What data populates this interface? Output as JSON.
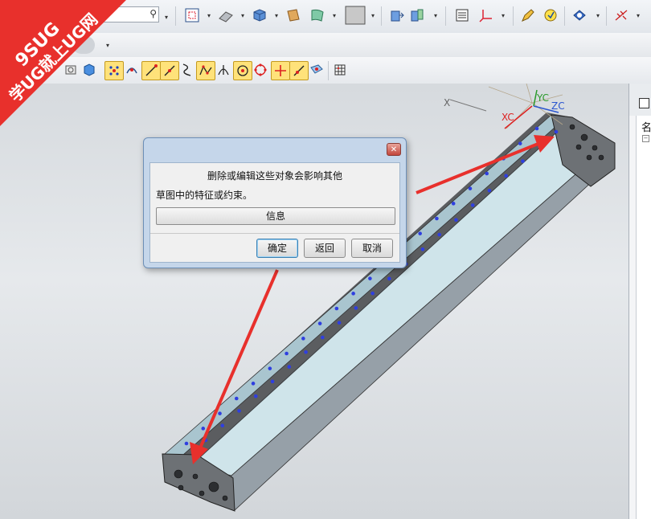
{
  "watermark": {
    "line1": "9SUG",
    "line2": "学UG就上UG网"
  },
  "toolbar": {
    "search_icon": "magnifier-icon",
    "row1_icons": [
      "fit-view-icon",
      "sketch-icon",
      "solid-box-icon",
      "sheet-icon",
      "surface-icon",
      "color-swatch-icon",
      "extrude-icon",
      "section-icon",
      "layer-icon",
      "csys-icon",
      "edit-object-icon",
      "analysis-icon",
      "render-icon",
      "snap-icon"
    ],
    "row3_icons": [
      "pattern-icon",
      "reference-icon",
      "point-snap-icon",
      "arc-snap-icon",
      "end-point-icon",
      "mid-point-icon",
      "curve-icon",
      "control-point-icon",
      "intersection-icon",
      "arc-center-icon",
      "quadrant-icon",
      "existing-point-icon",
      "point-on-curve-icon",
      "point-on-face-icon",
      "grid-icon"
    ]
  },
  "viewport": {
    "axis_labels": {
      "x": "X",
      "xc": "XC",
      "yc": "YC",
      "zc": "ZC"
    }
  },
  "right_panel": {
    "header_label": "名"
  },
  "dialog": {
    "message": "删除或编辑这些对象会影响其他",
    "sub_message": "草图中的特征或约束。",
    "info_label": "信息",
    "ok_label": "确定",
    "back_label": "返回",
    "cancel_label": "取消",
    "close_symbol": "✕"
  },
  "colors": {
    "accent_red": "#e8302c",
    "hole_blue": "#2f3fe0",
    "part_face": "#cfe4ea"
  }
}
